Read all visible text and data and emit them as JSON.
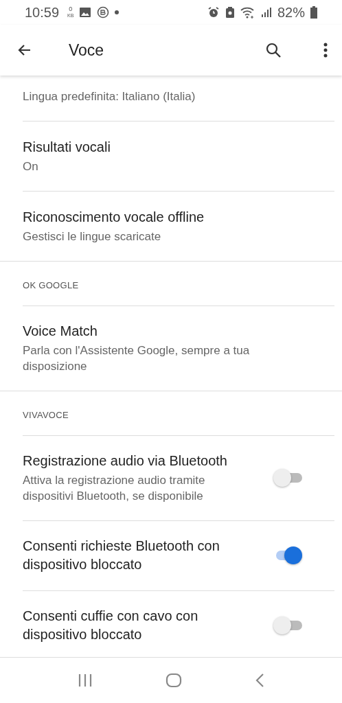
{
  "status_bar": {
    "time": "10:59",
    "data_rate": "0",
    "data_unit": "KB",
    "battery": "82%"
  },
  "app_bar": {
    "title": "Voce"
  },
  "sections": [
    {
      "items": [
        {
          "kind": "text",
          "subtitle": "Lingua predefinita: Italiano (Italia)"
        },
        {
          "kind": "text",
          "title": "Risultati vocali",
          "subtitle": "On"
        },
        {
          "kind": "text",
          "title": "Riconoscimento vocale offline",
          "subtitle": "Gestisci le lingue scaricate"
        }
      ]
    },
    {
      "header": "OK GOOGLE",
      "items": [
        {
          "kind": "text",
          "title": "Voice Match",
          "subtitle": "Parla con l'Assistente Google, sempre a tua disposizione"
        }
      ]
    },
    {
      "header": "VIVAVOCE",
      "items": [
        {
          "kind": "toggle",
          "title": "Registrazione audio via Bluetooth",
          "subtitle": "Attiva la registrazione audio tramite dispositivi Bluetooth, se disponibile",
          "on": false
        },
        {
          "kind": "toggle",
          "title": "Consenti richieste Bluetooth con dispositivo bloccato",
          "on": true
        },
        {
          "kind": "toggle",
          "title": "Consenti cuffie con cavo con dispositivo bloccato",
          "on": false
        }
      ]
    }
  ]
}
